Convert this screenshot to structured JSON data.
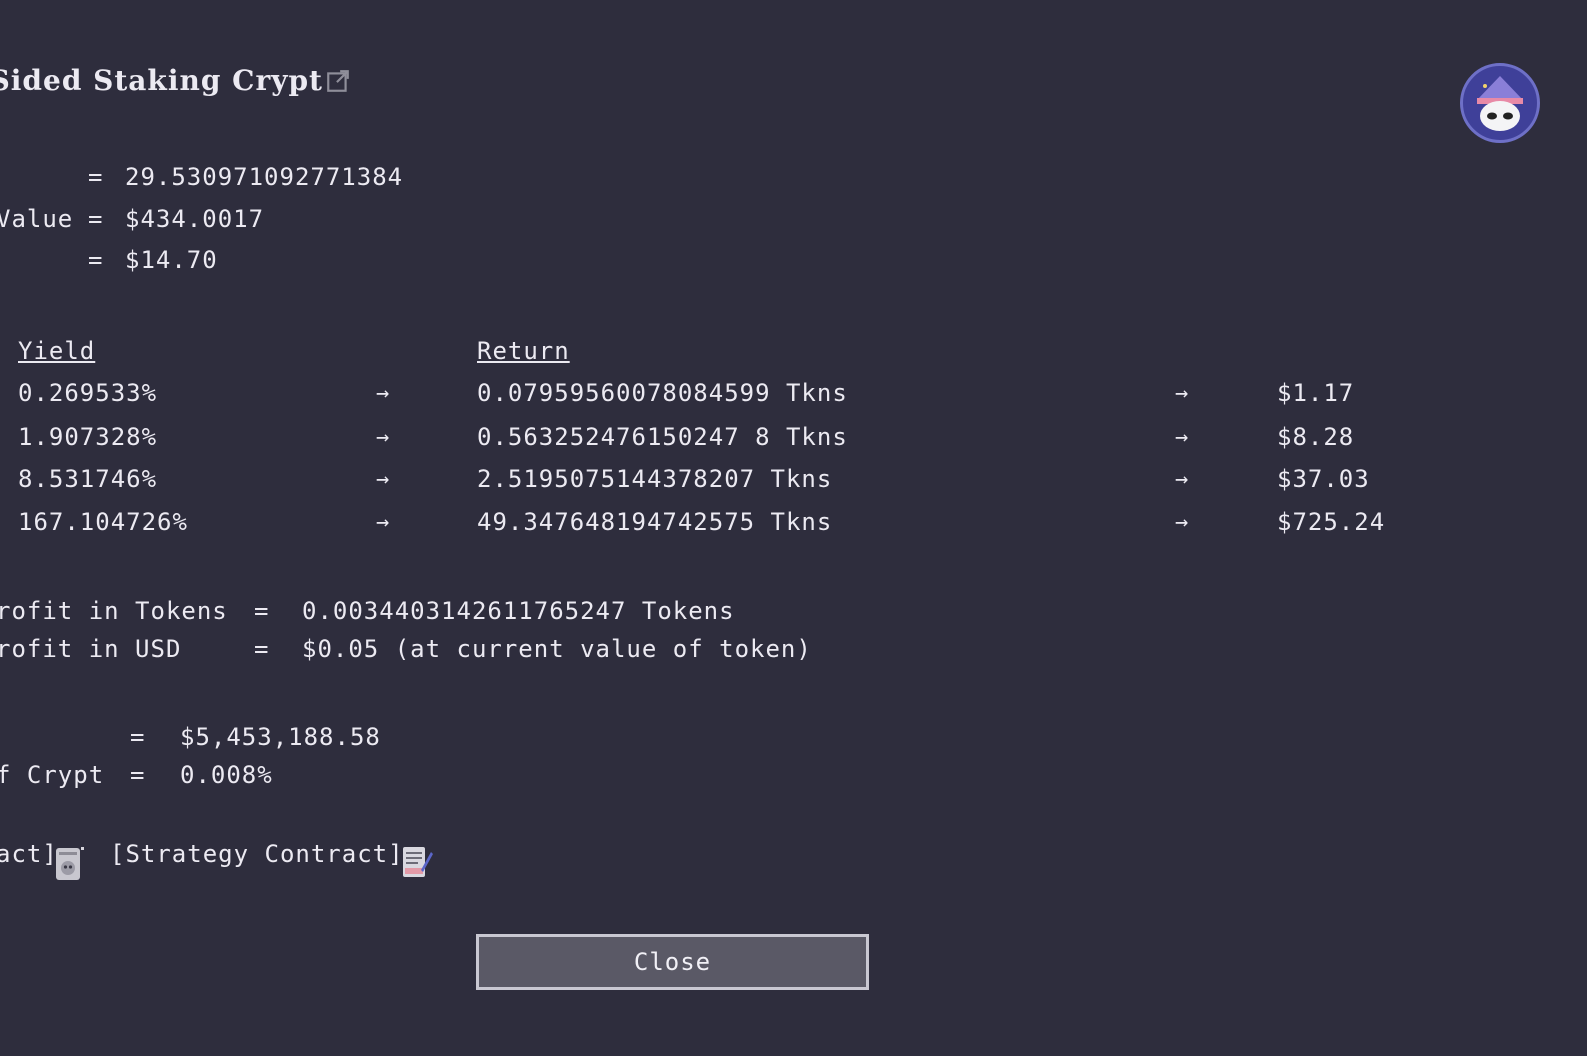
{
  "header": {
    "title": "e Sided Staking Crypt"
  },
  "stats": {
    "row1": {
      "label": "",
      "eq": "=",
      "value": "29.530971092771384"
    },
    "row2": {
      "label": "Value",
      "eq": "=",
      "value": "$434.0017"
    },
    "row3": {
      "label": "",
      "eq": "=",
      "value": "$14.70"
    }
  },
  "table": {
    "headers": {
      "yield": "Yield",
      "return": "Return"
    },
    "arrow": "→",
    "rows": [
      {
        "yield": "0.269533%",
        "return": "0.07959560078084599 Tkns",
        "usd": "$1.17"
      },
      {
        "yield": "1.907328%",
        "return": "0.563252476150247 8 Tkns",
        "usd": "$8.28"
      },
      {
        "yield": "8.531746%",
        "return": "2.5195075144378207 Tkns",
        "usd": "$37.03"
      },
      {
        "yield": "167.104726%",
        "return": "49.347648194742575 Tkns",
        "usd": "$725.24"
      }
    ]
  },
  "profit": {
    "tokens_label": "rofit in Tokens",
    "tokens_eq": "=",
    "tokens_value": "0.0034403142611765247 Tokens",
    "usd_label": "rofit in USD",
    "usd_eq": "=",
    "usd_value": "$0.05 (at current value of token)"
  },
  "tvl": {
    "row1_label": "",
    "row1_eq": "=",
    "row1_value": "$5,453,188.58",
    "row2_label": "f Crypt",
    "row2_eq": "=",
    "row2_value": "0.008%"
  },
  "links": {
    "contract": "act]",
    "strategy": "[Strategy Contract]"
  },
  "footer": {
    "close_label": "Close"
  },
  "icons": {
    "external": "external-link-icon",
    "avatar": "wizard-avatar-icon",
    "contract": "contract-scroll-icon",
    "strategy": "strategy-document-icon"
  },
  "colors": {
    "background": "#2e2d3d",
    "text": "#eceaf2",
    "button": "#5a5966",
    "avatar": "#3f4099"
  }
}
